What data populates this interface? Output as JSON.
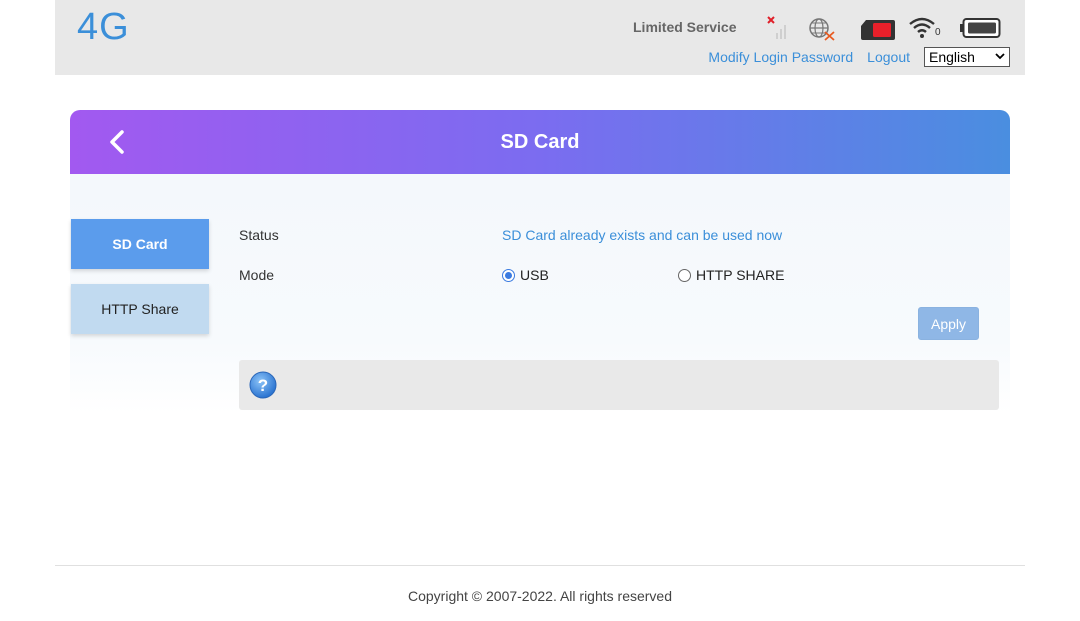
{
  "header": {
    "logo": "4G",
    "network_status": "Limited Service",
    "wifi_clients": "0",
    "links": {
      "modify_password": "Modify Login Password",
      "logout": "Logout"
    },
    "language": "English"
  },
  "icons": {
    "signal": "signal-no-service-icon",
    "internet": "globe-disconnected-icon",
    "sim": "sim-card-icon",
    "wifi": "wifi-icon",
    "battery": "battery-icon"
  },
  "page": {
    "title": "SD Card",
    "tabs": [
      {
        "label": "SD Card",
        "active": true
      },
      {
        "label": "HTTP Share",
        "active": false
      }
    ],
    "status_label": "Status",
    "status_value": "SD Card already exists and can be used now",
    "mode_label": "Mode",
    "mode_options": [
      {
        "label": "USB",
        "selected": true
      },
      {
        "label": "HTTP SHARE",
        "selected": false
      }
    ],
    "apply_label": "Apply"
  },
  "footer": {
    "copyright": "Copyright © 2007-2022. All rights reserved"
  },
  "colors": {
    "accent": "#3b8fd9",
    "gradient_start": "#a259f0",
    "gradient_end": "#4a8ee0",
    "active_tab": "#5b9cec",
    "inactive_tab": "#c1daf0",
    "apply_button": "#8fb7e6",
    "sim_red": "#e8202a"
  }
}
